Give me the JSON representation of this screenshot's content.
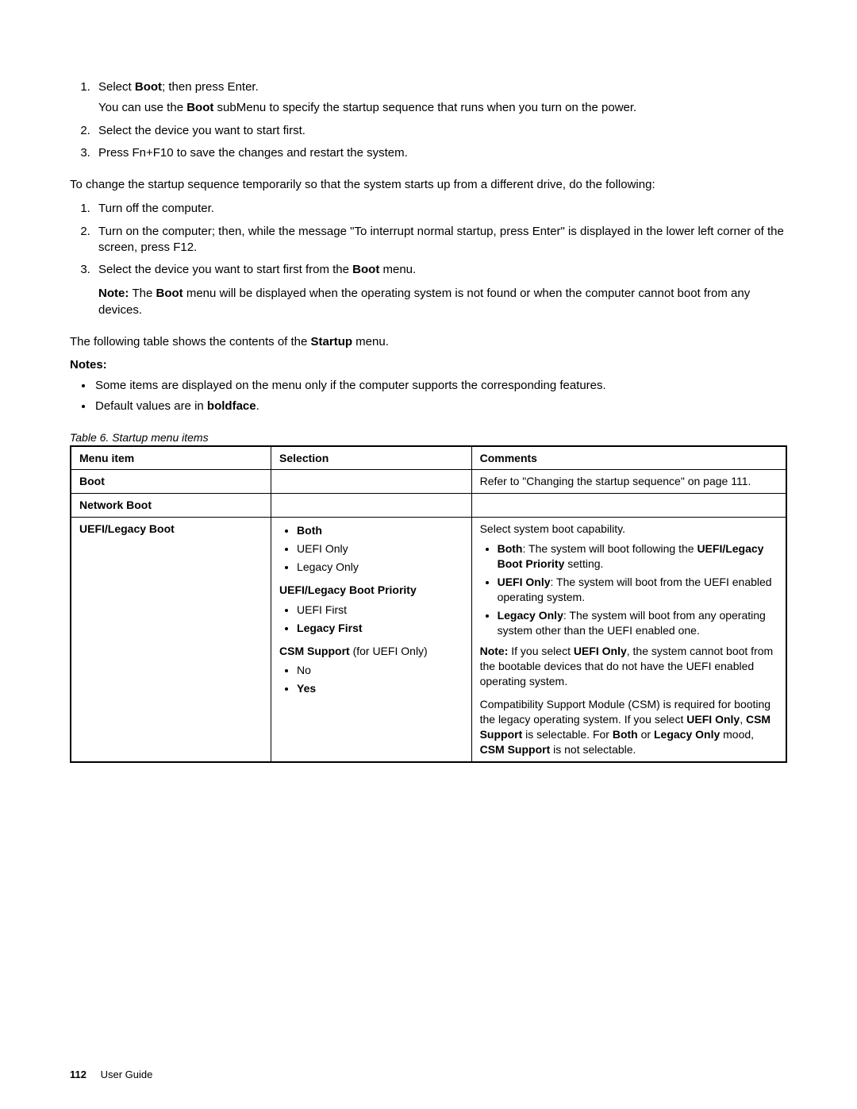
{
  "list1": {
    "i1a": "Select ",
    "i1b": "Boot",
    "i1c": "; then press Enter.",
    "i1p_a": "You can use the ",
    "i1p_b": "Boot",
    "i1p_c": " subMenu to specify the startup sequence that runs when you turn on the power.",
    "i2": "Select the device you want to start first.",
    "i3": "Press Fn+F10 to save the changes and restart the system."
  },
  "para1": "To change the startup sequence temporarily so that the system starts up from a different drive, do the following:",
  "list2": {
    "i1": "Turn off the computer.",
    "i2": "Turn on the computer; then, while the message \"To interrupt normal startup, press Enter\" is displayed in the lower left corner of the screen, press F12.",
    "i3a": "Select the device you want to start first from the ",
    "i3b": "Boot",
    "i3c": " menu.",
    "note_a": "Note: ",
    "note_b": "The ",
    "note_c": "Boot",
    "note_d": " menu will be displayed when the operating system is not found or when the computer cannot boot from any devices."
  },
  "para2a": "The following table shows the contents of the ",
  "para2b": "Startup",
  "para2c": " menu.",
  "notes_label": "Notes:",
  "notes": {
    "n1": "Some items are displayed on the menu only if the computer supports the corresponding features.",
    "n2a": "Default values are in ",
    "n2b": "boldface",
    "n2c": "."
  },
  "table_caption": "Table 6.  Startup menu items",
  "th1": "Menu item",
  "th2": "Selection",
  "th3": "Comments",
  "row1": {
    "c1": "Boot",
    "c3": "Refer to \"Changing the startup sequence\" on page 111."
  },
  "row2": {
    "c1": "Network Boot"
  },
  "row3": {
    "c1": "UEFI/Legacy Boot",
    "sel_both": "Both",
    "sel_uefi": "UEFI Only",
    "sel_legacy": "Legacy Only",
    "priority_head": "UEFI/Legacy Boot Priority",
    "p_uefi": "UEFI First",
    "p_legacy": "Legacy First",
    "csm_head_a": "CSM Support",
    "csm_head_b": " (for UEFI Only)",
    "csm_no": "No",
    "csm_yes": "Yes",
    "com_intro": "Select system boot capability.",
    "com_both_a": "Both",
    "com_both_b": ": The system will boot following the ",
    "com_both_c": "UEFI/Legacy Boot Priority",
    "com_both_d": " setting.",
    "com_uefi_a": "UEFI Only",
    "com_uefi_b": ": The system will boot from the UEFI enabled operating system.",
    "com_leg_a": "Legacy Only",
    "com_leg_b": ": The system will boot from any operating system other than the UEFI enabled one.",
    "com_note_a": "Note: ",
    "com_note_b": "If you select ",
    "com_note_c": "UEFI Only",
    "com_note_d": ", the system cannot boot from the bootable devices that do not have the UEFI enabled operating system.",
    "com_csm_a": "Compatibility Support Module (CSM) is required for booting the legacy operating system. If you select ",
    "com_csm_b": "UEFI Only",
    "com_csm_c": ", ",
    "com_csm_d": "CSM Support",
    "com_csm_e": " is selectable. For ",
    "com_csm_f": "Both",
    "com_csm_g": " or ",
    "com_csm_h": "Legacy Only",
    "com_csm_i": " mood, ",
    "com_csm_j": "CSM Support",
    "com_csm_k": " is not selectable."
  },
  "footer": {
    "page": "112",
    "title": "User Guide"
  }
}
